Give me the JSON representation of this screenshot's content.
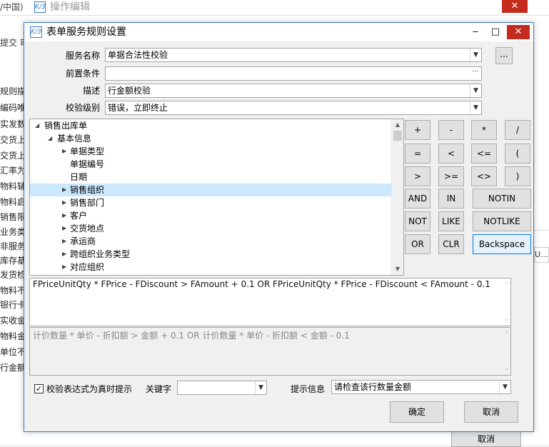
{
  "background": {
    "left_title": "/中国)",
    "window_title": "操作编辑",
    "logo": "K/3",
    "close_glyph": "✕",
    "toolbar_text": "提交  审",
    "left_rows": [
      "规则描",
      "编码唯",
      "实发数",
      "交货上",
      "交货上",
      "汇率为",
      "物料辅",
      "物料启",
      "销售限",
      "业务类",
      "非服务",
      "库存基",
      "发货检",
      "物料不",
      "银行卡",
      "实收金",
      "物料金",
      "单位不",
      "行金额"
    ],
    "cancel_label": "取消",
    "right_text": "U..."
  },
  "dialog": {
    "title": "表单服务规则设置",
    "logo": "K/3",
    "minimize_glyph": "‒",
    "maximize_glyph": "□",
    "close_glyph": "✕",
    "fields": {
      "service_name": {
        "label": "服务名称",
        "value": "单据合法性校验"
      },
      "precondition": {
        "label": "前置条件",
        "value": ""
      },
      "description": {
        "label": "描述",
        "value": "行金额校验"
      },
      "check_level": {
        "label": "校验级别",
        "value": "错误，立即终止"
      }
    },
    "more_button": "...",
    "tree": {
      "root": "销售出库单",
      "group": "基本信息",
      "items": [
        "单据类型",
        "单据编号",
        "日期",
        "销售组织",
        "销售部门",
        "客户",
        "交货地点",
        "承运商",
        "跨组织业务类型",
        "对应组织"
      ],
      "expandable": [
        true,
        false,
        false,
        true,
        true,
        true,
        true,
        true,
        true,
        true
      ],
      "selected_index": 3
    },
    "operators": {
      "row1": [
        "+",
        "-",
        "*",
        "/"
      ],
      "row2": [
        "=",
        "<",
        "<=",
        "("
      ],
      "row3": [
        ">",
        ">=",
        "<>",
        ")"
      ],
      "row4": [
        "AND",
        "IN",
        "NOTIN"
      ],
      "row5": [
        "NOT",
        "LIKE",
        "NOTLIKE"
      ],
      "row6": [
        "OR",
        "CLR",
        "Backspace"
      ]
    },
    "expression": "FPriceUnitQty  *  FPrice -  FDiscount   >  FAmount  + 0.1  OR FPriceUnitQty  *  FPrice -  FDiscount   <  FAmount  - 0.1",
    "expression_description": "计价数量  *  单价 -  折扣额   >  金额  + 0.1  OR 计价数量  *  单价 -  折扣额   <  金额  - 0.1",
    "realtime_checkbox": {
      "label": "校验表达式为真时提示",
      "checked": true,
      "glyph": "✓"
    },
    "keyword": {
      "label": "关键字",
      "value": ""
    },
    "hint": {
      "label": "提示信息",
      "value": "请检查该行数量金额"
    },
    "ok_label": "确定",
    "cancel_label": "取消"
  }
}
